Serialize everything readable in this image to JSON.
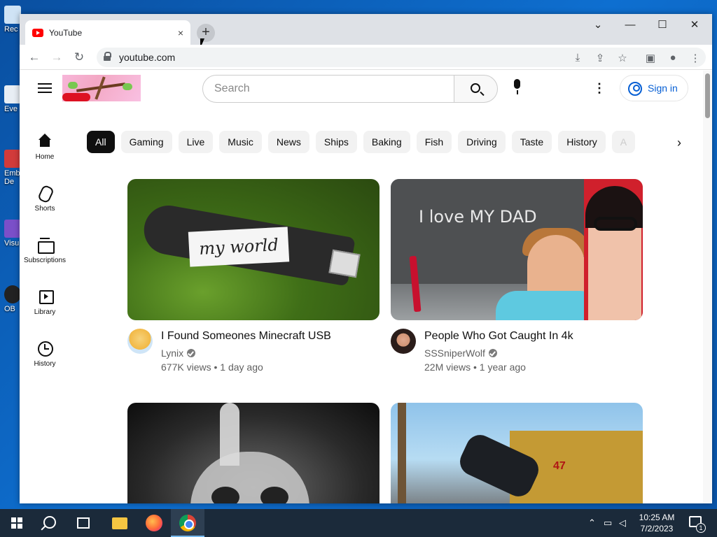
{
  "desktop": {
    "icons": [
      {
        "label": "Rec",
        "name": "recycle-bin"
      },
      {
        "label": "Eve",
        "name": "everything"
      },
      {
        "label": "Emb De",
        "name": "embedded-app"
      },
      {
        "label": "Visu",
        "name": "visual-studio"
      },
      {
        "label": "OB",
        "name": "obs"
      }
    ]
  },
  "browser": {
    "tab_title": "YouTube",
    "tab_close": "×",
    "new_tab": "+",
    "url": "youtube.com"
  },
  "youtube": {
    "search_placeholder": "Search",
    "sign_in": "Sign in",
    "guide": [
      {
        "label": "Home",
        "icon": "home-icon"
      },
      {
        "label": "Shorts",
        "icon": "shorts-icon"
      },
      {
        "label": "Subscriptions",
        "icon": "subscriptions-icon"
      },
      {
        "label": "Library",
        "icon": "library-icon"
      },
      {
        "label": "History",
        "icon": "history-icon"
      }
    ],
    "chips": [
      "All",
      "Gaming",
      "Live",
      "Music",
      "News",
      "Ships",
      "Baking",
      "Fish",
      "Driving",
      "Taste",
      "History",
      "A"
    ],
    "videos": [
      {
        "title": "I Found Someones Minecraft USB",
        "channel": "Lynix",
        "stats": "677K views • 1 day ago",
        "thumb_text": "my world"
      },
      {
        "title": "People Who Got Caught In 4k",
        "channel": "SSSniperWolf",
        "stats": "22M views • 1 year ago",
        "thumb_text": "I love MY DAD"
      },
      {
        "title": "",
        "channel": "",
        "stats": ""
      },
      {
        "title": "",
        "channel": "",
        "stats": ""
      }
    ]
  },
  "taskbar": {
    "time": "10:25 AM",
    "date": "7/2/2023",
    "notification_count": "1"
  }
}
